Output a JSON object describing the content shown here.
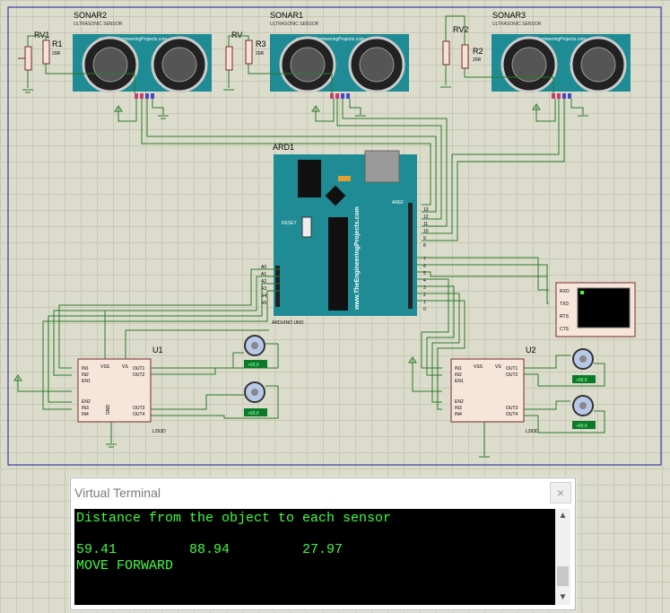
{
  "schematic": {
    "sonars": [
      {
        "ref": "SONAR2",
        "subtitle": "ULTRASONIC SENSOR",
        "brand": "www.TheEngineeringProjects.com",
        "pot": "RV1",
        "resistor": "R1",
        "res_value": "20R"
      },
      {
        "ref": "SONAR1",
        "subtitle": "ULTRASONIC SENSOR",
        "brand": "www.TheEngineeringProjects.com",
        "pot": "RV",
        "resistor": "R3",
        "res_value": "20R"
      },
      {
        "ref": "SONAR3",
        "subtitle": "ULTRASONIC SENSOR",
        "brand": "www.TheEngineeringProjects.com",
        "pot": "RV2",
        "resistor": "R2",
        "res_value": "20R"
      }
    ],
    "arduino": {
      "ref": "ARD1",
      "name": "ARDUINO UNO",
      "brand": "www.TheEngineeringProjects.com",
      "aref": "AREF",
      "reset": "RESET"
    },
    "drivers": [
      {
        "ref": "U1",
        "part": "L293D"
      },
      {
        "ref": "U2",
        "part": "L293D"
      }
    ],
    "motor_value": "+88.8",
    "terminal_pins": [
      "RXD",
      "TXD",
      "RTS",
      "CTS"
    ],
    "analog_pins": [
      "A0",
      "A1",
      "A2",
      "A3",
      "A4",
      "A5"
    ],
    "digital_pins": [
      "13",
      "12",
      "11",
      "10",
      "9",
      "8",
      "7",
      "6",
      "5",
      "4",
      "3",
      "2",
      "1",
      "0"
    ]
  },
  "terminal": {
    "title": "Virtual Terminal",
    "close_label": "×",
    "lines": [
      "Distance from the object to each sensor",
      "",
      "59.41         88.94         27.97",
      "MOVE FORWARD"
    ]
  }
}
